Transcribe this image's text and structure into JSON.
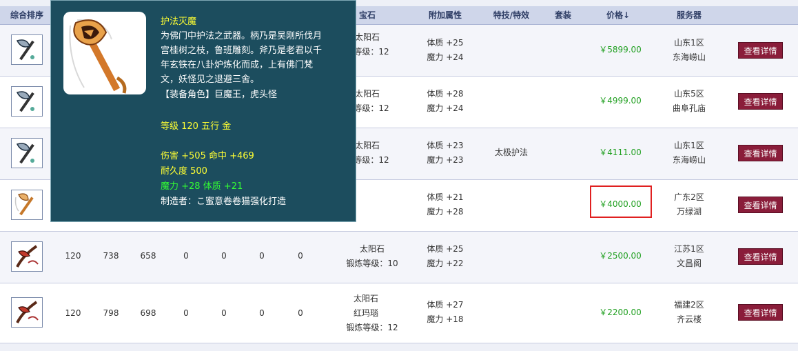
{
  "header": {
    "rank": "综合排序",
    "gem": "宝石",
    "attr": "附加属性",
    "skill": "特技/特效",
    "set": "套装",
    "price": "价格↓",
    "server": "服务器"
  },
  "rows": [
    {
      "gem1": "太阳石",
      "gem2": "",
      "gem3": "等级：12",
      "attr1": "体质 +25",
      "attr2": "魔力 +24",
      "skill": "",
      "price": "￥5899.00",
      "server1": "山东1区",
      "server2": "东海崂山",
      "btn": "查看详情"
    },
    {
      "gem1": "太阳石",
      "gem2": "",
      "gem3": "等级：12",
      "attr1": "体质 +28",
      "attr2": "魔力 +24",
      "skill": "",
      "price": "￥4999.00",
      "server1": "山东5区",
      "server2": "曲阜孔庙",
      "btn": "查看详情"
    },
    {
      "gem1": "太阳石",
      "gem2": "",
      "gem3": "等级：12",
      "attr1": "体质 +23",
      "attr2": "魔力 +23",
      "skill": "太极护法",
      "price": "￥4111.00",
      "server1": "山东1区",
      "server2": "东海崂山",
      "btn": "查看详情"
    },
    {
      "gem1": "",
      "gem2": "",
      "gem3": "",
      "attr1": "体质 +21",
      "attr2": "魔力 +28",
      "skill": "",
      "price": "￥4000.00",
      "server1": "广东2区",
      "server2": "万绿湖",
      "btn": "查看详情"
    },
    {
      "c1": "120",
      "c2": "738",
      "c3": "658",
      "c4": "0",
      "c5": "0",
      "c6": "0",
      "c7": "0",
      "gem1": "太阳石",
      "gem2": "",
      "gem3": "锻炼等级：10",
      "attr1": "体质 +25",
      "attr2": "魔力 +22",
      "skill": "",
      "price": "￥2500.00",
      "server1": "江苏1区",
      "server2": "文昌阁",
      "btn": "查看详情"
    },
    {
      "c1": "120",
      "c2": "798",
      "c3": "698",
      "c4": "0",
      "c5": "0",
      "c6": "0",
      "c7": "0",
      "gem1": "太阳石",
      "gem2": "红玛瑙",
      "gem3": "锻炼等级：12",
      "attr1": "体质 +27",
      "attr2": "魔力 +18",
      "skill": "",
      "price": "￥2200.00",
      "server1": "福建2区",
      "server2": "齐云楼",
      "btn": "查看详情"
    }
  ],
  "tooltip": {
    "name": "护法灭魔",
    "desc1": "为佛门中护法之武器。柄乃是吴刚所伐月",
    "desc2": "宫桂树之枝，鲁班雕刻。斧乃是老君以千",
    "desc3": "年玄铁在八卦炉炼化而成，上有佛门梵",
    "desc4": "文，妖怪见之退避三舍。",
    "role": "【装备角色】巨魔王，虎头怪",
    "level": "等级 120  五行 金",
    "dmg": "伤害 +505  命中 +469",
    "durability": "耐久度 500",
    "bonus": "魔力 +28  体质 +21",
    "maker": "制造者：こ蜜意卷卷猫强化打造"
  },
  "colors": {
    "header_bg": "#cfd6ea",
    "button": "#8a1d3a",
    "price": "#1f9f1f",
    "tooltip_bg": "#1c4d5e",
    "highlight": "#e02020"
  }
}
